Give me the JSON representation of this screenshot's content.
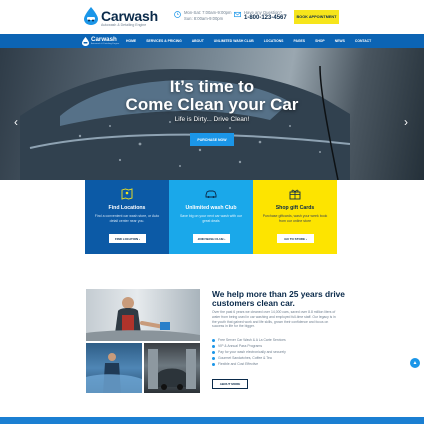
{
  "colors": {
    "brand_navy": "#0a2a4a",
    "nav_blue": "#0c64b4",
    "accent_blue": "#1b96e8",
    "accent_yellow": "#f6e51b",
    "card_navy": "#0c5aa6",
    "card_cyan": "#1aa8ea",
    "card_yellow": "#fde400"
  },
  "header": {
    "logo_title": "Carwash",
    "logo_tagline": "Autowash & Detailing Engine",
    "hours_line1": "Mon-Sat: 7:00am-9:00pm",
    "hours_line2": "Sun: 8:00am-9:00pm",
    "contact_label": "Have any Question?",
    "phone": "1-800-123-4567",
    "appointment_label": "BOOK APPOINTMENT"
  },
  "nav": {
    "logo_title": "Carwash",
    "logo_tagline": "Autowash & Detailing Engine",
    "items": [
      "HOME",
      "SERVICES & PRICING",
      "ABOUT",
      "UNLIMITED WASH CLUB",
      "LOCATIONS",
      "PAGES",
      "SHOP",
      "NEWS",
      "CONTACT"
    ]
  },
  "hero": {
    "line1": "It’s time to",
    "line2": "Come Clean your Car",
    "subtitle": "Life is Dirty... Drive Clean!",
    "button_label": "PURCHASE NOW"
  },
  "cards": [
    {
      "title": "Find Locations",
      "text": "Find a convenient car wash store, or Auto detail center near you.",
      "button": "FIND LOCATION ›",
      "icon": "map-icon"
    },
    {
      "title": "Unlimited wash Club",
      "text": "Save big on your next car wash with our great deals",
      "button": "JOIN WASH CLUB ›",
      "icon": "car-icon"
    },
    {
      "title": "Shop gift Cards",
      "text": "Purchase giftcards, wash your week book from our online store",
      "button": "GO TO STORE ›",
      "icon": "gift-icon"
    }
  ],
  "about": {
    "title": "We help more than 25 years drive customers clean car.",
    "paragraph": "Over the past 6 years we cleaned over 14,000 cars, saved over 8.8 million liters of water from being used in car washing and employed full-time staff. Our legacy is in the youth that gained work and life skills, grown their confidence and focus on success in life for the bigger.",
    "features": [
      "Free Server Car Wash & A La Carte Services",
      "VIP & Annual Pass Programs",
      "Pay for your wash electronically and securely",
      "Gourmet Sandwiches, Coffee & Tea",
      "Flexible and Cost Effective"
    ],
    "button_label": "ABOUT MORE"
  }
}
